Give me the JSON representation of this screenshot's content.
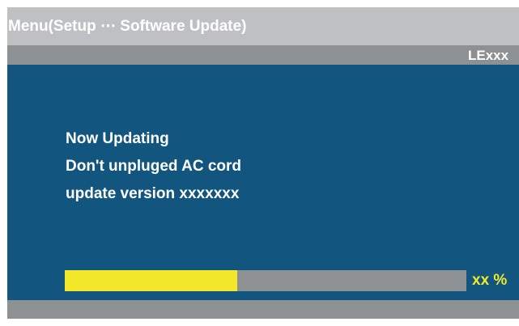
{
  "header": {
    "title": "Menu(Setup ⋯ Software Update)"
  },
  "model_bar": {
    "model": "LExxx"
  },
  "main": {
    "lines": [
      "Now Updating",
      "Don't unpluged AC cord",
      "update version  xxxxxxx"
    ]
  },
  "progress": {
    "fraction": 0.43,
    "label": "xx %"
  },
  "colors": {
    "title_bar": "#bec0c3",
    "bars": "#8d9193",
    "main_background": "#12557f",
    "progress_fill": "#f4e82c",
    "text": "#ffffff"
  }
}
